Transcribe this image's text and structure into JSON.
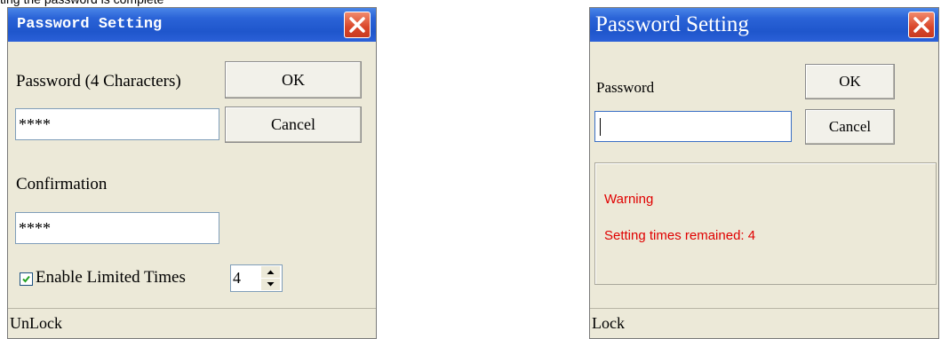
{
  "caption": "ting the password is complete",
  "dialog_left": {
    "title": "Password Setting",
    "password_label": "Password (4 Characters)",
    "password_value": "****",
    "ok_label": "OK",
    "cancel_label": "Cancel",
    "confirmation_label": "Confirmation",
    "confirmation_value": "****",
    "enable_limited_label": "Enable Limited Times",
    "enable_limited_checked": true,
    "limited_times_value": "4",
    "status": "UnLock"
  },
  "dialog_right": {
    "title": "Password Setting",
    "password_label": "Password",
    "password_value": "",
    "ok_label": "OK",
    "cancel_label": "Cancel",
    "warning_title": "Warning",
    "warning_text": "Setting times remained: 4",
    "status": "Lock"
  },
  "colors": {
    "titlebar": "#2a63d7",
    "dialog_bg": "#ece9d8",
    "warning": "#e00000",
    "close": "#d9462a"
  },
  "icons": [
    "close-icon",
    "checkbox-checked-icon",
    "spin-up-icon",
    "spin-down-icon"
  ]
}
